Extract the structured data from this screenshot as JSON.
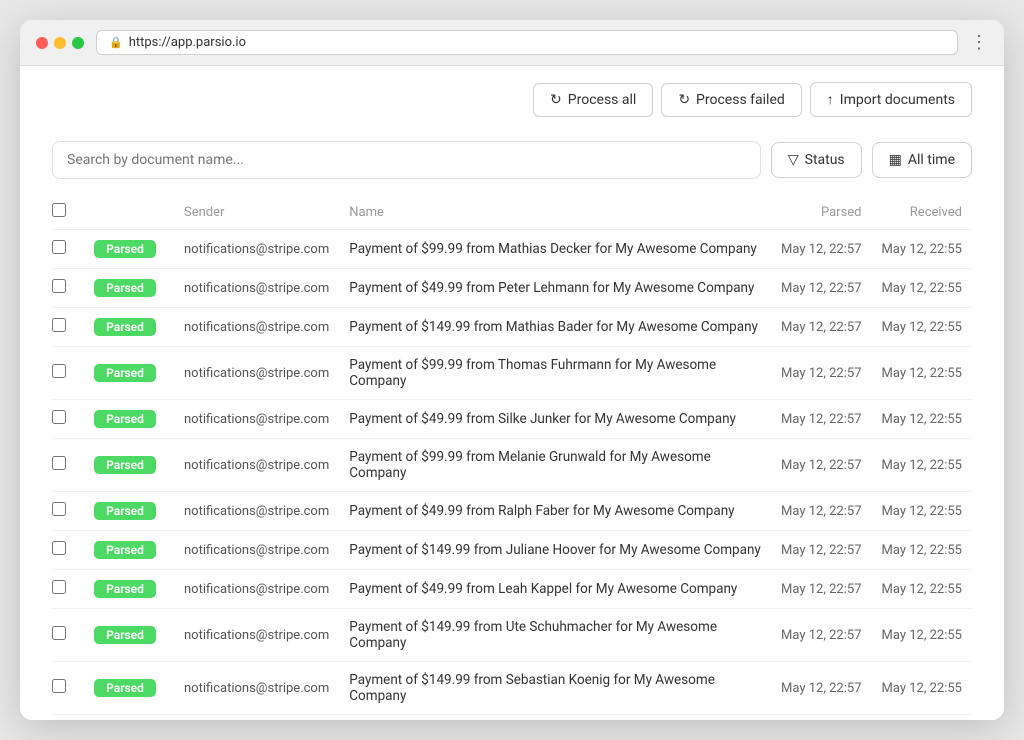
{
  "browser": {
    "url": "https://app.parsio.io"
  },
  "toolbar": {
    "process_all_label": "Process all",
    "process_failed_label": "Process failed",
    "import_documents_label": "Import documents"
  },
  "search": {
    "placeholder": "Search by document name..."
  },
  "filters": {
    "status_label": "Status",
    "time_label": "All time"
  },
  "table": {
    "headers": {
      "checkbox": "",
      "status": "",
      "sender": "Sender",
      "name": "Name",
      "parsed": "Parsed",
      "received": "Received"
    },
    "rows": [
      {
        "status": "Parsed",
        "sender": "notifications@stripe.com",
        "name": "Payment of $99.99 from Mathias Decker for My Awesome Company",
        "parsed": "May 12, 22:57",
        "received": "May 12, 22:55"
      },
      {
        "status": "Parsed",
        "sender": "notifications@stripe.com",
        "name": "Payment of $49.99 from Peter Lehmann for My Awesome Company",
        "parsed": "May 12, 22:57",
        "received": "May 12, 22:55"
      },
      {
        "status": "Parsed",
        "sender": "notifications@stripe.com",
        "name": "Payment of $149.99 from Mathias Bader for My Awesome Company",
        "parsed": "May 12, 22:57",
        "received": "May 12, 22:55"
      },
      {
        "status": "Parsed",
        "sender": "notifications@stripe.com",
        "name": "Payment of $99.99 from Thomas Fuhrmann for My Awesome Company",
        "parsed": "May 12, 22:57",
        "received": "May 12, 22:55"
      },
      {
        "status": "Parsed",
        "sender": "notifications@stripe.com",
        "name": "Payment of $49.99 from Silke Junker for My Awesome Company",
        "parsed": "May 12, 22:57",
        "received": "May 12, 22:55"
      },
      {
        "status": "Parsed",
        "sender": "notifications@stripe.com",
        "name": "Payment of $99.99 from Melanie Grunwald for My Awesome Company",
        "parsed": "May 12, 22:57",
        "received": "May 12, 22:55"
      },
      {
        "status": "Parsed",
        "sender": "notifications@stripe.com",
        "name": "Payment of $49.99 from Ralph Faber for My Awesome Company",
        "parsed": "May 12, 22:57",
        "received": "May 12, 22:55"
      },
      {
        "status": "Parsed",
        "sender": "notifications@stripe.com",
        "name": "Payment of $149.99 from Juliane Hoover for My Awesome Company",
        "parsed": "May 12, 22:57",
        "received": "May 12, 22:55"
      },
      {
        "status": "Parsed",
        "sender": "notifications@stripe.com",
        "name": "Payment of $49.99 from Leah Kappel for My Awesome Company",
        "parsed": "May 12, 22:57",
        "received": "May 12, 22:55"
      },
      {
        "status": "Parsed",
        "sender": "notifications@stripe.com",
        "name": "Payment of $149.99 from Ute Schuhmacher for My Awesome Company",
        "parsed": "May 12, 22:57",
        "received": "May 12, 22:55"
      },
      {
        "status": "Parsed",
        "sender": "notifications@stripe.com",
        "name": "Payment of $149.99 from Sebastian Koenig for My Awesome Company",
        "parsed": "May 12, 22:57",
        "received": "May 12, 22:55"
      }
    ]
  },
  "icons": {
    "refresh": "↻",
    "upload": "↑",
    "filter": "⊞",
    "calendar": "📅",
    "lock": "🔒",
    "menu": "⋮"
  }
}
